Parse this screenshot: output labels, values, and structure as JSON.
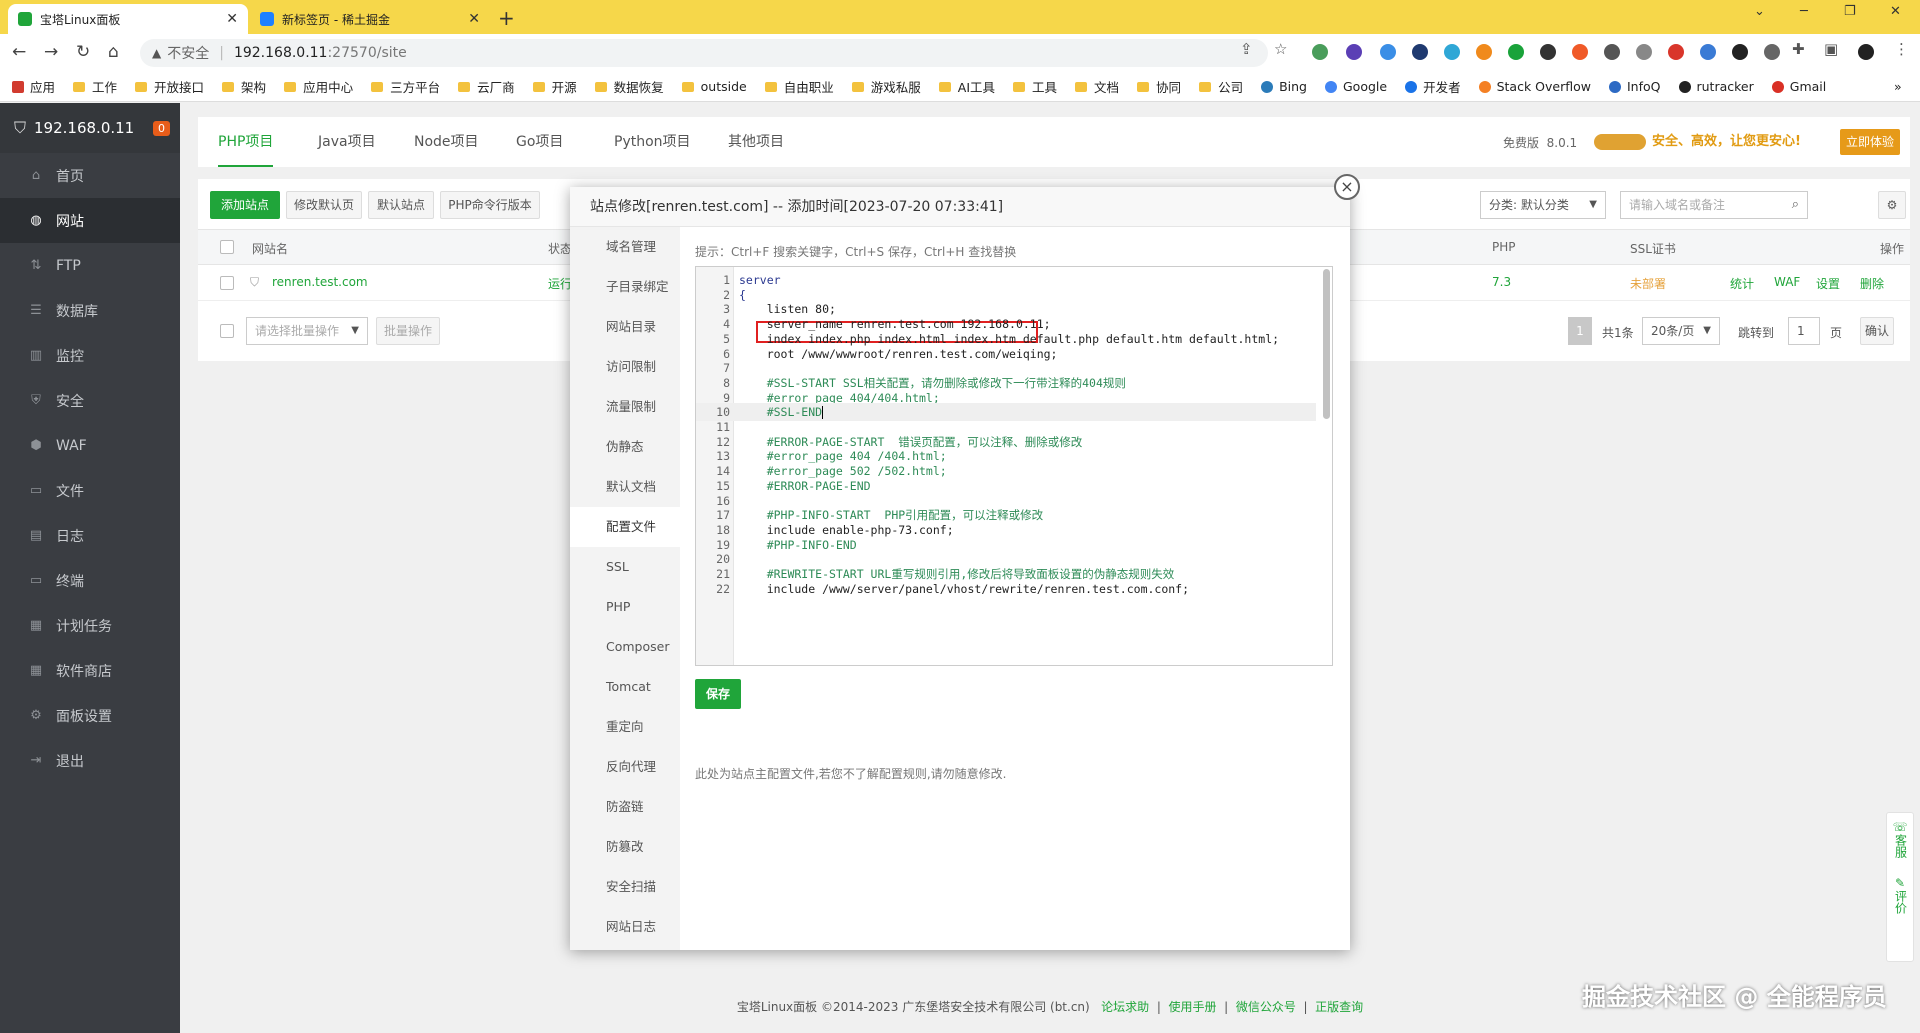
{
  "browser": {
    "tabs": [
      {
        "title": "宝塔Linux面板",
        "active": true
      },
      {
        "title": "新标签页 - 稀土掘金",
        "active": false
      }
    ],
    "new_tab": "+",
    "address": {
      "insecure_label": "不安全",
      "host": "192.168.0.11",
      "path": ":27570/site"
    },
    "bookmarks": [
      "应用",
      "工作",
      "开放接口",
      "架构",
      "应用中心",
      "三方平台",
      "云厂商",
      "开源",
      "数据恢复",
      "outside",
      "自由职业",
      "游戏私服",
      "AI工具",
      "工具",
      "文档",
      "协同",
      "公司",
      "Bing",
      "Google",
      "开发者",
      "Stack Overflow",
      "InfoQ",
      "rutracker",
      "Gmail"
    ],
    "bookmark_more": "»"
  },
  "sidebar": {
    "host": "192.168.0.11",
    "badge": "0",
    "items": [
      {
        "label": "首页",
        "icon": "home-icon"
      },
      {
        "label": "网站",
        "icon": "globe-icon",
        "active": true
      },
      {
        "label": "FTP",
        "icon": "ftp-icon"
      },
      {
        "label": "数据库",
        "icon": "database-icon"
      },
      {
        "label": "监控",
        "icon": "monitor-icon"
      },
      {
        "label": "安全",
        "icon": "shield-icon"
      },
      {
        "label": "WAF",
        "icon": "waf-icon"
      },
      {
        "label": "文件",
        "icon": "folder-icon"
      },
      {
        "label": "日志",
        "icon": "log-icon"
      },
      {
        "label": "终端",
        "icon": "terminal-icon"
      },
      {
        "label": "计划任务",
        "icon": "schedule-icon"
      },
      {
        "label": "软件商店",
        "icon": "store-icon"
      },
      {
        "label": "面板设置",
        "icon": "settings-icon"
      },
      {
        "label": "退出",
        "icon": "logout-icon"
      }
    ]
  },
  "page": {
    "project_tabs": [
      "PHP项目",
      "Java项目",
      "Node项目",
      "Go项目",
      "Python项目",
      "其他项目"
    ],
    "edition": "免费版",
    "version": "8.0.1",
    "slogan": "安全、高效，让您更安心!",
    "trial_button": "立即体验",
    "toolbar": {
      "add_site": "添加站点",
      "edit_default_page": "修改默认页",
      "default_site": "默认站点",
      "php_cli_version": "PHP命令行版本",
      "category": "分类: 默认分类",
      "search_placeholder": "请输入域名或备注"
    },
    "table": {
      "headers": {
        "site": "网站名",
        "status": "状态",
        "php": "PHP",
        "ssl": "SSL证书",
        "actions": "操作"
      },
      "row": {
        "site": "renren.test.com",
        "status": "运行",
        "php": "7.3",
        "ssl": "未部署",
        "actions": [
          "统计",
          "WAF",
          "设置",
          "删除"
        ]
      }
    },
    "batch": {
      "select_placeholder": "请选择批量操作",
      "batch_button": "批量操作"
    },
    "pager": {
      "current": "1",
      "total": "共1条",
      "per_page": "20条/页",
      "jump_label": "跳转到",
      "jump_value": "1",
      "page_label": "页",
      "confirm": "确认"
    },
    "footer": {
      "copyright": "宝塔Linux面板 ©2014-2023 广东堡塔安全技术有限公司 (bt.cn)",
      "links": [
        "论坛求助",
        "使用手册",
        "微信公众号",
        "正版查询"
      ]
    },
    "float": {
      "service": "客服",
      "rate": "评价"
    },
    "watermark": "掘金技术社区 @ 全能程序员"
  },
  "modal": {
    "title": "站点修改[renren.test.com] -- 添加时间[2023-07-20 07:33:41]",
    "close": "×",
    "nav": [
      "域名管理",
      "子目录绑定",
      "网站目录",
      "访问限制",
      "流量限制",
      "伪静态",
      "默认文档",
      "配置文件",
      "SSL",
      "PHP",
      "Composer",
      "Tomcat",
      "重定向",
      "反向代理",
      "防盗链",
      "防篡改",
      "安全扫描",
      "网站日志"
    ],
    "active_nav": "配置文件",
    "hint": "提示：Ctrl+F 搜索关键字，Ctrl+S 保存，Ctrl+H 查找替换",
    "code_lines": [
      "server",
      "{",
      "    listen 80;",
      "    server_name renren.test.com 192.168.0.11;",
      "    index index.php index.html index.htm default.php default.htm default.html;",
      "    root /www/wwwroot/renren.test.com/weiqing;",
      "",
      "    #SSL-START SSL相关配置，请勿删除或修改下一行带注释的404规则",
      "    #error_page 404/404.html;",
      "    #SSL-END",
      "",
      "    #ERROR-PAGE-START  错误页配置，可以注释、删除或修改",
      "    #error_page 404 /404.html;",
      "    #error_page 502 /502.html;",
      "    #ERROR-PAGE-END",
      "",
      "    #PHP-INFO-START  PHP引用配置，可以注释或修改",
      "    include enable-php-73.conf;",
      "    #PHP-INFO-END",
      "",
      "    #REWRITE-START URL重写规则引用,修改后将导致面板设置的伪静态规则失效",
      "    include /www/server/panel/vhost/rewrite/renren.test.com.conf;"
    ],
    "save_button": "保存",
    "note": "此处为站点主配置文件,若您不了解配置规则,请勿随意修改."
  }
}
